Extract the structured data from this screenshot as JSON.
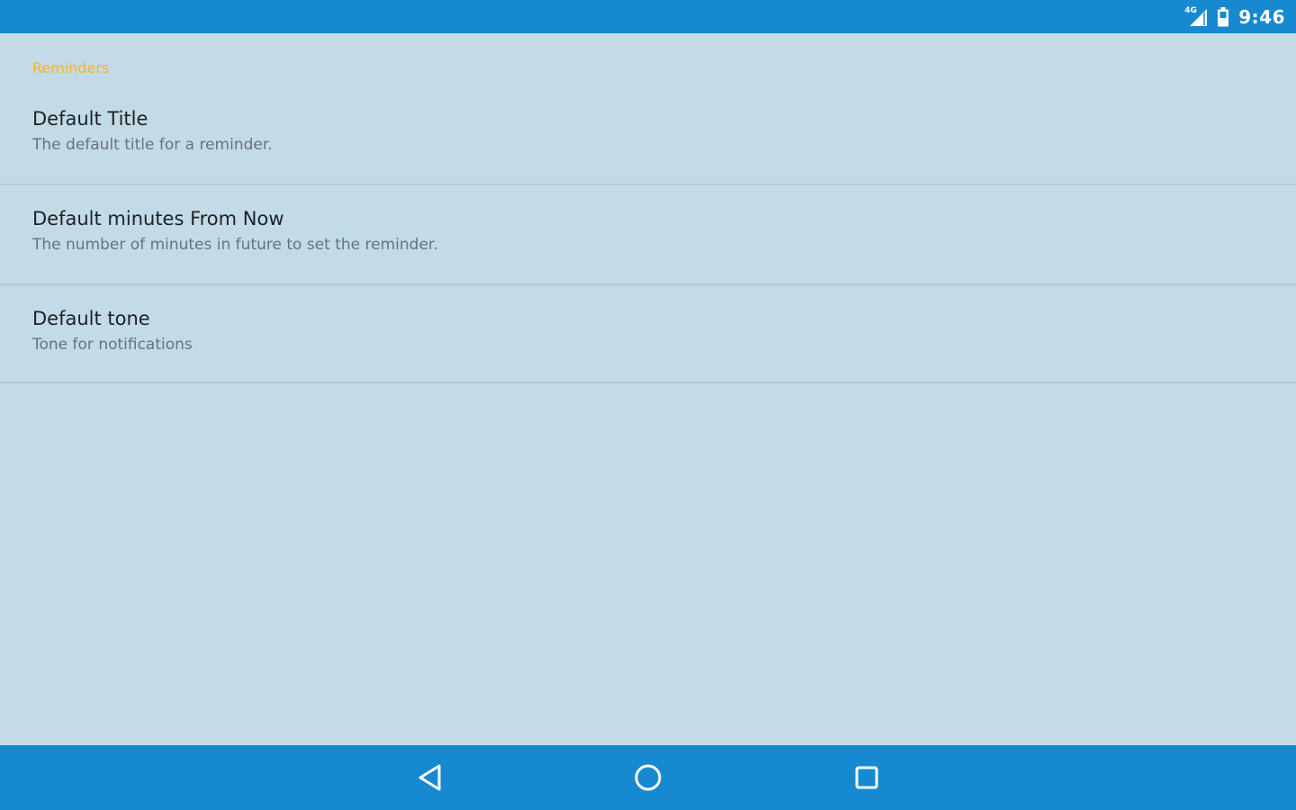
{
  "status_bar": {
    "network_type": "4G",
    "time": "9:46",
    "icons": [
      "signal-icon",
      "battery-icon"
    ],
    "background_color": "#1789d1"
  },
  "preferences": {
    "category_title": "Reminders",
    "category_color": "#f5b421",
    "items": [
      {
        "title": "Default Title",
        "summary": "The default title for a reminder."
      },
      {
        "title": "Default minutes From Now",
        "summary": "The number of minutes in future to set the reminder."
      },
      {
        "title": "Default tone",
        "summary": "Tone for notifications"
      }
    ]
  },
  "navigation_bar": {
    "icons": [
      "back-icon",
      "home-icon",
      "recents-icon"
    ],
    "background_color": "#1789d1"
  }
}
